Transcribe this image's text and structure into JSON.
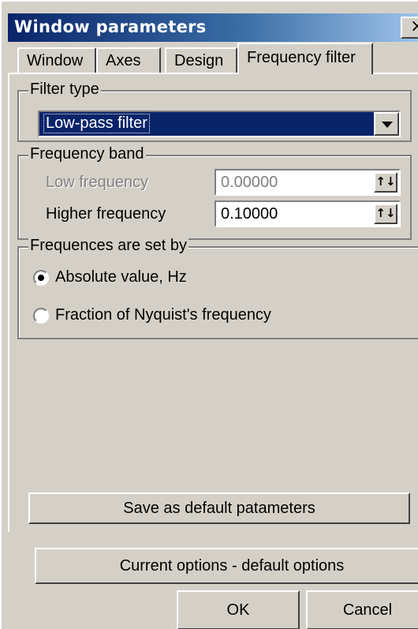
{
  "window": {
    "title": "Window parameters",
    "close_glyph": "×"
  },
  "tabs": [
    {
      "label": "Window"
    },
    {
      "label": "Axes"
    },
    {
      "label": "Design"
    },
    {
      "label": "Frequency filter",
      "active": true
    }
  ],
  "filter_type": {
    "legend": "Filter type",
    "selected": "Low-pass filter"
  },
  "frequency_band": {
    "legend": "Frequency band",
    "low_label": "Low frequency",
    "low_value": "0.00000",
    "high_label": "Higher frequency",
    "high_value": "0.10000"
  },
  "set_by": {
    "legend": "Frequences are set by",
    "options": [
      {
        "label": "Absolute value, Hz",
        "checked": true
      },
      {
        "label": "Fraction of Nyquist's frequency",
        "checked": false
      }
    ]
  },
  "buttons": {
    "save_default": "Save as default patameters",
    "current_default": "Current options - default options",
    "ok": "OK",
    "cancel": "Cancel"
  },
  "icons": {
    "dropdown": "chevron-down-icon",
    "spin": "spin-updown-icon"
  }
}
